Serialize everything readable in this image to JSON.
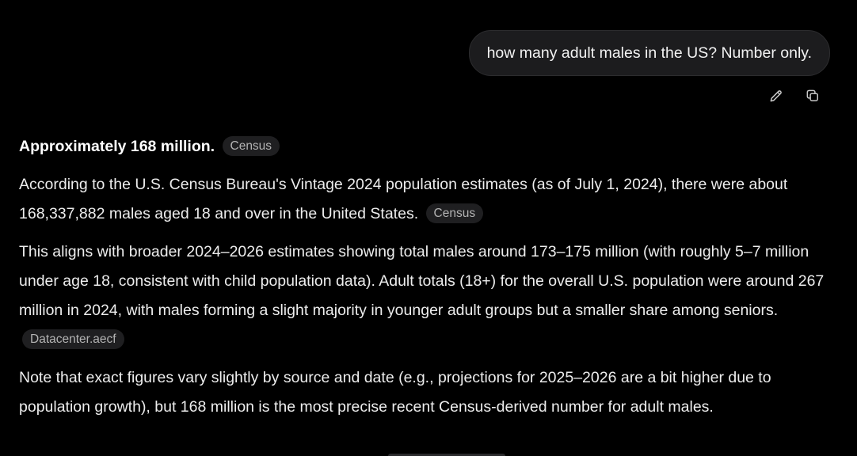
{
  "user_message": {
    "text": "how many adult males in the US? Number only."
  },
  "message_actions": {
    "edit_icon": "pencil-icon",
    "copy_icon": "copy-icon"
  },
  "answer": {
    "p1": {
      "bold": "Approximately 168 million.",
      "citation": "Census"
    },
    "p2": {
      "text": "According to the U.S. Census Bureau's Vintage 2024 population estimates (as of July 1, 2024), there were about 168,337,882 males aged 18 and over in the United States.",
      "citation": "Census"
    },
    "p3": {
      "text": "This aligns with broader 2024–2026 estimates showing total males around 173–175 million (with roughly 5–7 million under age 18, consistent with child population data). Adult totals (18+) for the overall U.S. population were around 267 million in 2024, with males forming a slight majority in younger adult groups but a smaller share among seniors.",
      "citation": "Datacenter.aecf"
    },
    "p4": {
      "text": "Note that exact figures vary slightly by source and date (e.g., projections for 2025–2026 are a bit higher due to population growth), but 168 million is the most precise recent Census-derived number for adult males."
    }
  },
  "colors": {
    "background": "#000000",
    "bubble": "#1c1c1e",
    "citation_bg": "#1f1f21",
    "citation_text": "#b3b3b3"
  }
}
